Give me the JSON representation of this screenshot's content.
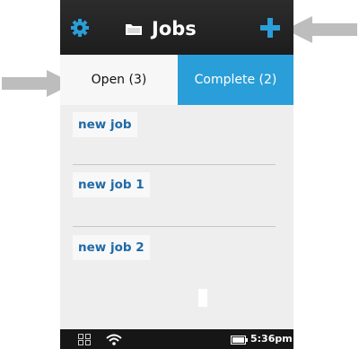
{
  "header": {
    "title": "Jobs",
    "settings_icon": "gear-icon",
    "folder_icon": "folder-icon",
    "add_icon": "plus-icon",
    "icon_accent": "#2a9ed8"
  },
  "tabs": [
    {
      "label": "Open (3)",
      "selected": true
    },
    {
      "label": "Complete (2)",
      "selected": false,
      "color": "#2a9ed8"
    }
  ],
  "jobs": [
    {
      "name": "new job"
    },
    {
      "name": "new job 1"
    },
    {
      "name": "new job 2"
    }
  ],
  "status_bar": {
    "time": "5:36pm",
    "icons": [
      "grid-icon",
      "wifi-icon",
      "battery-icon"
    ]
  },
  "annotations": {
    "arrows": [
      "arrow-to-add-button",
      "arrow-to-open-tab"
    ],
    "arrow_color": "#bdbdbd"
  }
}
